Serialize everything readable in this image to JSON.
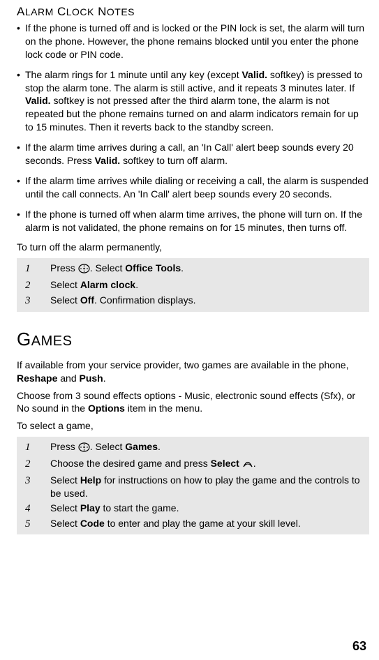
{
  "section1": {
    "title_caps": [
      "A",
      "LARM",
      " C",
      "LOCK",
      " N",
      "OTES"
    ],
    "bullets": [
      {
        "pre": "If the phone is turned off and is locked or the PIN lock is set, the alarm will turn on the phone. However, the phone remains blocked until you enter the phone lock code or PIN code."
      },
      {
        "pre": "The alarm rings for 1 minute until any key (except ",
        "b1": "Valid.",
        "mid1": " softkey) is pressed to stop the alarm tone. The alarm is still active, and it repeats 3 minutes later. If  ",
        "b2": "Valid.",
        "mid2": " softkey is not pressed after the third alarm tone, the alarm is not repeated but the phone remains turned on and alarm indicators remain for up to 15 minutes. Then it reverts back to the standby screen."
      },
      {
        "pre": "If the alarm time arrives during a call, an 'In Call' alert beep sounds every 20 seconds. Press  ",
        "b1": "Valid.",
        "mid1": " softkey to turn off alarm."
      },
      {
        "pre": "If the alarm time arrives while dialing or receiving a call, the alarm is suspended until the call connects. An 'In Call' alert beep sounds every 20 seconds."
      },
      {
        "pre": "If the phone is turned off when alarm time arrives, the phone will turn on. If the alarm is not validated, the phone remains on for 15 minutes, then turns off."
      }
    ],
    "intro": "To turn off the alarm permanently,",
    "steps": [
      {
        "n": "1",
        "pre": "Press ",
        "icon": "nav",
        "mid": ". Select ",
        "b": "Office Tools",
        "post": "."
      },
      {
        "n": "2",
        "pre": "Select ",
        "b": "Alarm clock",
        "post": "."
      },
      {
        "n": "3",
        "pre": "Select ",
        "b": "Off",
        "post": ". Confirmation displays."
      }
    ]
  },
  "section2": {
    "title_caps": [
      "G",
      "AMES"
    ],
    "para1_pre": "If available from your service provider, two games are available in the phone,  ",
    "para1_b1": "Reshape",
    "para1_mid": " and  ",
    "para1_b2": "Push",
    "para1_post": ".",
    "para2_pre": "Choose from 3 sound effects options - Music, electronic sound effects (Sfx), or No sound in the  ",
    "para2_b": "Options",
    "para2_post": " item in the menu.",
    "intro": "To select a game,",
    "steps": [
      {
        "n": "1",
        "pre": "Press ",
        "icon": "nav",
        "mid": ". Select ",
        "b": "Games",
        "post": "."
      },
      {
        "n": "2",
        "pre": "Choose the desired game and press ",
        "b": "Select",
        "post": " ",
        "icon2": "arc",
        "post2": "."
      },
      {
        "n": "3",
        "pre": "Select ",
        "b": "Help",
        "post": " for instructions on how to play the game and the controls to be used."
      },
      {
        "n": "4",
        "pre": "Select ",
        "b": "Play",
        "post": " to start the game."
      },
      {
        "n": "5",
        "pre": "Select ",
        "b": "Code",
        "post": " to enter and play the game at your skill level."
      }
    ]
  },
  "page_number": "63"
}
